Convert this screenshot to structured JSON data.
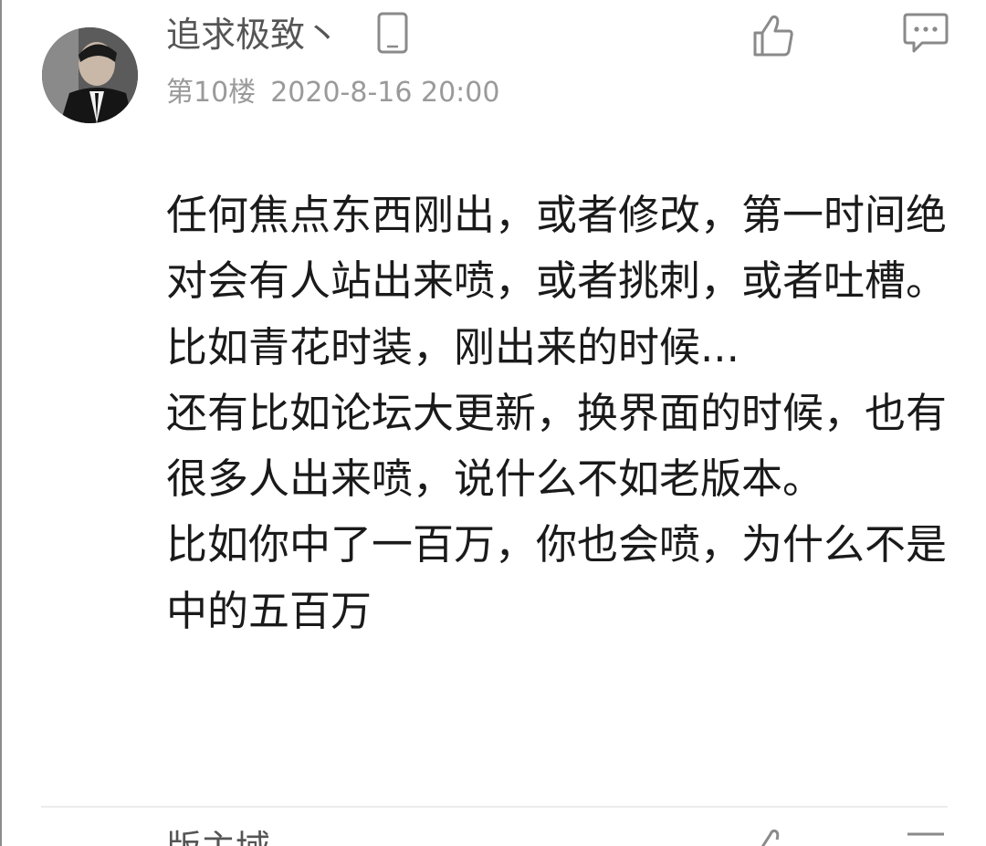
{
  "post": {
    "username": "追求极致丶",
    "floor": "第10楼",
    "timestamp": "2020-8-16 20:00",
    "icons": {
      "device": "phone-icon",
      "like": "thumbs-up-icon",
      "reply": "comment-icon"
    },
    "content_lines": [
      "任何焦点东西刚出，或者修改，第一时间绝对会有人站出来喷，或者挑刺，或者吐槽。",
      "比如青花时装，刚出来的时候...",
      "还有比如论坛大更新，换界面的时候，也有很多人出来喷，说什么不如老版本。",
      "比如你中了一百万，你也会喷，为什么不是中的五百万"
    ]
  },
  "next_post": {
    "username_partial": "版主域"
  },
  "colors": {
    "username": "#555555",
    "meta": "#9a9a9a",
    "content": "#1a1a1a",
    "icon": "#8a8a8a"
  }
}
